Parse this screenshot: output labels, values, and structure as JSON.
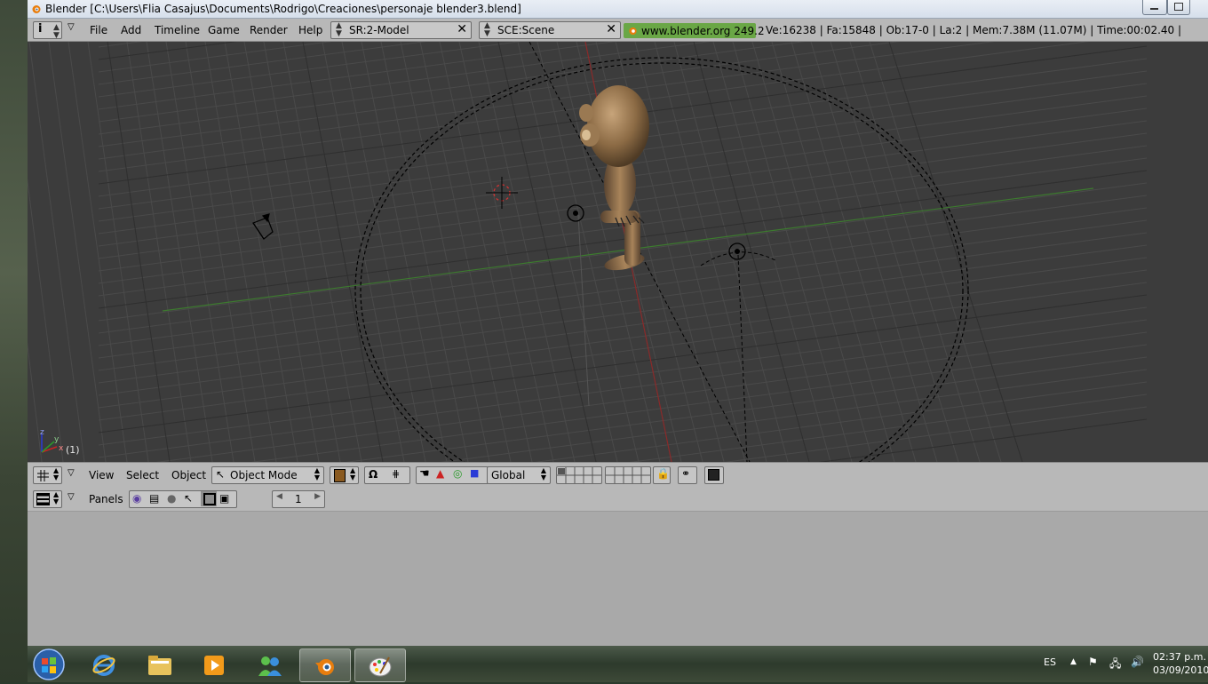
{
  "window": {
    "title": "Blender [C:\\Users\\Flia Casajus\\Documents\\Rodrigo\\Creaciones\\personaje blender3.blend]"
  },
  "header": {
    "menus": [
      "File",
      "Add",
      "Timeline",
      "Game",
      "Render",
      "Help"
    ],
    "screen_field": "SR:2-Model",
    "scene_field": "SCE:Scene",
    "version_badge": "www.blender.org 249.2",
    "stats": "Ve:16238 | Fa:15848 | Ob:17-0 | La:2  | Mem:7.38M (11.07M)  | Time:00:02.40 |"
  },
  "viewport": {
    "frame_label": "(1)",
    "axis_z": "z",
    "axis_x": "x",
    "axis_y": "y"
  },
  "header3d": {
    "menus": [
      "View",
      "Select",
      "Object"
    ],
    "mode": "Object Mode",
    "orientation": "Global"
  },
  "buttons_window": {
    "panels_label": "Panels",
    "frame_number": "1"
  },
  "taskbar": {
    "language": "ES",
    "time": "02:37 p.m.",
    "date": "03/09/2010"
  },
  "icons": {
    "blender": "blender-logo-icon",
    "ie": "internet-explorer-icon",
    "folder": "folder-icon",
    "media": "media-player-icon",
    "messenger": "messenger-icon",
    "paint": "paint-icon",
    "start": "start-orb-icon"
  },
  "colors": {
    "grid_bg": "#3c3c3c",
    "badge_green": "#6aa746",
    "character": "#8b6a44"
  }
}
